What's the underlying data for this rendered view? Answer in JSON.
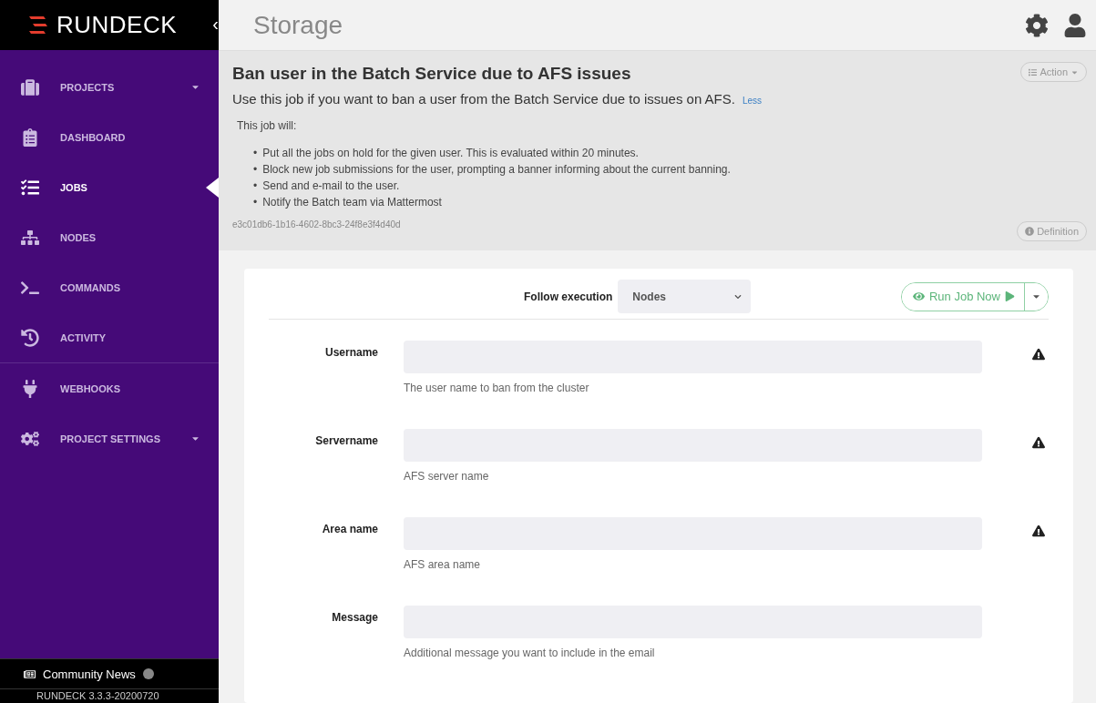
{
  "brand": {
    "name": "RUNDECK",
    "collapse_glyph": "‹"
  },
  "page_title": "Storage",
  "sidebar": {
    "sections": [
      [
        {
          "label": "PROJECTS",
          "selected": false,
          "has_menu": true
        },
        {
          "label": "DASHBOARD",
          "selected": false,
          "has_menu": false
        },
        {
          "label": "JOBS",
          "selected": true,
          "has_menu": false
        },
        {
          "label": "NODES",
          "selected": false,
          "has_menu": false
        },
        {
          "label": "COMMANDS",
          "selected": false,
          "has_menu": false
        },
        {
          "label": "ACTIVITY",
          "selected": false,
          "has_menu": false
        }
      ],
      [
        {
          "label": "WEBHOOKS",
          "selected": false,
          "has_menu": false
        },
        {
          "label": "PROJECT SETTINGS",
          "selected": false,
          "has_menu": true
        }
      ]
    ],
    "community_news": "Community News",
    "version": "RUNDECK 3.3.3-20200720"
  },
  "job": {
    "title": "Ban user in the Batch Service due to AFS issues",
    "summary": "Use this job if you want to ban a user from the Batch Service due to issues on AFS.",
    "less_link": "Less",
    "action_button": "Action",
    "intro": "This job will:",
    "bullets": [
      {
        "marker": "•",
        "text": "Put all the jobs on hold for the given user. This is evaluated within 20 minutes."
      },
      {
        "marker": "•",
        "text": "Block new job submissions for the user, prompting a banner informing about the current banning."
      },
      {
        "marker": "•",
        "text": "Send and e-mail to the user."
      },
      {
        "marker": "•",
        "text": "Notify the Batch team via Mattermost"
      }
    ],
    "uuid": "e3c01db6-1b16-4602-8bc3-24f8e3f4d40d",
    "definition_button": "Definition"
  },
  "run": {
    "follow_label": "Follow execution",
    "follow_value": "Nodes",
    "run_button": "Run Job Now"
  },
  "options": [
    {
      "label": "Username",
      "hint": "The user name to ban from the cluster",
      "required": true
    },
    {
      "label": "Servername",
      "hint": "AFS server name",
      "required": true
    },
    {
      "label": "Area name",
      "hint": "AFS area name",
      "required": true
    },
    {
      "label": "Message",
      "hint": "Additional message you want to include in the email",
      "required": false
    }
  ]
}
